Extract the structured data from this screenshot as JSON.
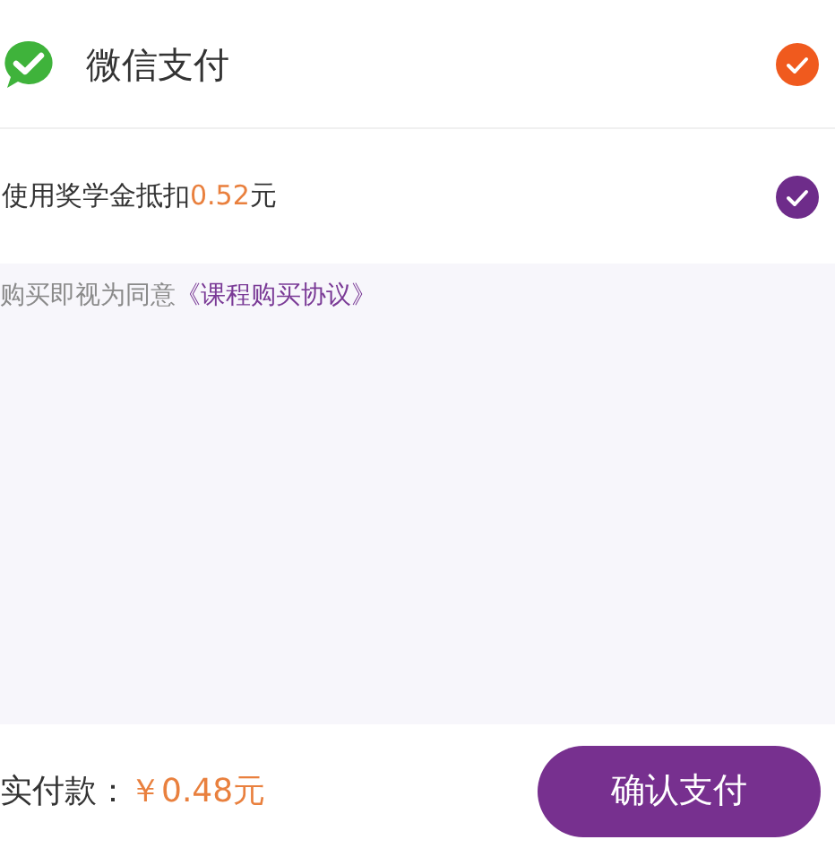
{
  "payment_method": {
    "label": "微信支付",
    "checked": true
  },
  "scholarship": {
    "prefix": "使用奖学金抵扣",
    "amount": "0.52",
    "suffix": "元",
    "checked": true
  },
  "agreement": {
    "text": "购买即视为同意",
    "link": "《课程购买协议》"
  },
  "footer": {
    "total_label": "实付款：",
    "total_amount": "￥0.48元",
    "confirm_button": "确认支付"
  }
}
